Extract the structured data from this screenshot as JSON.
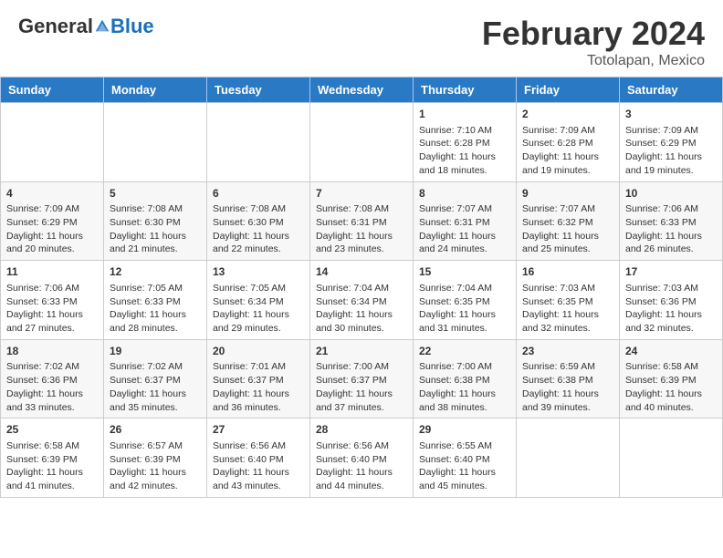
{
  "header": {
    "logo_general": "General",
    "logo_blue": "Blue",
    "month_title": "February 2024",
    "location": "Totolapan, Mexico"
  },
  "days_of_week": [
    "Sunday",
    "Monday",
    "Tuesday",
    "Wednesday",
    "Thursday",
    "Friday",
    "Saturday"
  ],
  "weeks": [
    [
      {
        "day": "",
        "content": ""
      },
      {
        "day": "",
        "content": ""
      },
      {
        "day": "",
        "content": ""
      },
      {
        "day": "",
        "content": ""
      },
      {
        "day": "1",
        "content": "Sunrise: 7:10 AM\nSunset: 6:28 PM\nDaylight: 11 hours and 18 minutes."
      },
      {
        "day": "2",
        "content": "Sunrise: 7:09 AM\nSunset: 6:28 PM\nDaylight: 11 hours and 19 minutes."
      },
      {
        "day": "3",
        "content": "Sunrise: 7:09 AM\nSunset: 6:29 PM\nDaylight: 11 hours and 19 minutes."
      }
    ],
    [
      {
        "day": "4",
        "content": "Sunrise: 7:09 AM\nSunset: 6:29 PM\nDaylight: 11 hours and 20 minutes."
      },
      {
        "day": "5",
        "content": "Sunrise: 7:08 AM\nSunset: 6:30 PM\nDaylight: 11 hours and 21 minutes."
      },
      {
        "day": "6",
        "content": "Sunrise: 7:08 AM\nSunset: 6:30 PM\nDaylight: 11 hours and 22 minutes."
      },
      {
        "day": "7",
        "content": "Sunrise: 7:08 AM\nSunset: 6:31 PM\nDaylight: 11 hours and 23 minutes."
      },
      {
        "day": "8",
        "content": "Sunrise: 7:07 AM\nSunset: 6:31 PM\nDaylight: 11 hours and 24 minutes."
      },
      {
        "day": "9",
        "content": "Sunrise: 7:07 AM\nSunset: 6:32 PM\nDaylight: 11 hours and 25 minutes."
      },
      {
        "day": "10",
        "content": "Sunrise: 7:06 AM\nSunset: 6:33 PM\nDaylight: 11 hours and 26 minutes."
      }
    ],
    [
      {
        "day": "11",
        "content": "Sunrise: 7:06 AM\nSunset: 6:33 PM\nDaylight: 11 hours and 27 minutes."
      },
      {
        "day": "12",
        "content": "Sunrise: 7:05 AM\nSunset: 6:33 PM\nDaylight: 11 hours and 28 minutes."
      },
      {
        "day": "13",
        "content": "Sunrise: 7:05 AM\nSunset: 6:34 PM\nDaylight: 11 hours and 29 minutes."
      },
      {
        "day": "14",
        "content": "Sunrise: 7:04 AM\nSunset: 6:34 PM\nDaylight: 11 hours and 30 minutes."
      },
      {
        "day": "15",
        "content": "Sunrise: 7:04 AM\nSunset: 6:35 PM\nDaylight: 11 hours and 31 minutes."
      },
      {
        "day": "16",
        "content": "Sunrise: 7:03 AM\nSunset: 6:35 PM\nDaylight: 11 hours and 32 minutes."
      },
      {
        "day": "17",
        "content": "Sunrise: 7:03 AM\nSunset: 6:36 PM\nDaylight: 11 hours and 32 minutes."
      }
    ],
    [
      {
        "day": "18",
        "content": "Sunrise: 7:02 AM\nSunset: 6:36 PM\nDaylight: 11 hours and 33 minutes."
      },
      {
        "day": "19",
        "content": "Sunrise: 7:02 AM\nSunset: 6:37 PM\nDaylight: 11 hours and 35 minutes."
      },
      {
        "day": "20",
        "content": "Sunrise: 7:01 AM\nSunset: 6:37 PM\nDaylight: 11 hours and 36 minutes."
      },
      {
        "day": "21",
        "content": "Sunrise: 7:00 AM\nSunset: 6:37 PM\nDaylight: 11 hours and 37 minutes."
      },
      {
        "day": "22",
        "content": "Sunrise: 7:00 AM\nSunset: 6:38 PM\nDaylight: 11 hours and 38 minutes."
      },
      {
        "day": "23",
        "content": "Sunrise: 6:59 AM\nSunset: 6:38 PM\nDaylight: 11 hours and 39 minutes."
      },
      {
        "day": "24",
        "content": "Sunrise: 6:58 AM\nSunset: 6:39 PM\nDaylight: 11 hours and 40 minutes."
      }
    ],
    [
      {
        "day": "25",
        "content": "Sunrise: 6:58 AM\nSunset: 6:39 PM\nDaylight: 11 hours and 41 minutes."
      },
      {
        "day": "26",
        "content": "Sunrise: 6:57 AM\nSunset: 6:39 PM\nDaylight: 11 hours and 42 minutes."
      },
      {
        "day": "27",
        "content": "Sunrise: 6:56 AM\nSunset: 6:40 PM\nDaylight: 11 hours and 43 minutes."
      },
      {
        "day": "28",
        "content": "Sunrise: 6:56 AM\nSunset: 6:40 PM\nDaylight: 11 hours and 44 minutes."
      },
      {
        "day": "29",
        "content": "Sunrise: 6:55 AM\nSunset: 6:40 PM\nDaylight: 11 hours and 45 minutes."
      },
      {
        "day": "",
        "content": ""
      },
      {
        "day": "",
        "content": ""
      }
    ]
  ]
}
